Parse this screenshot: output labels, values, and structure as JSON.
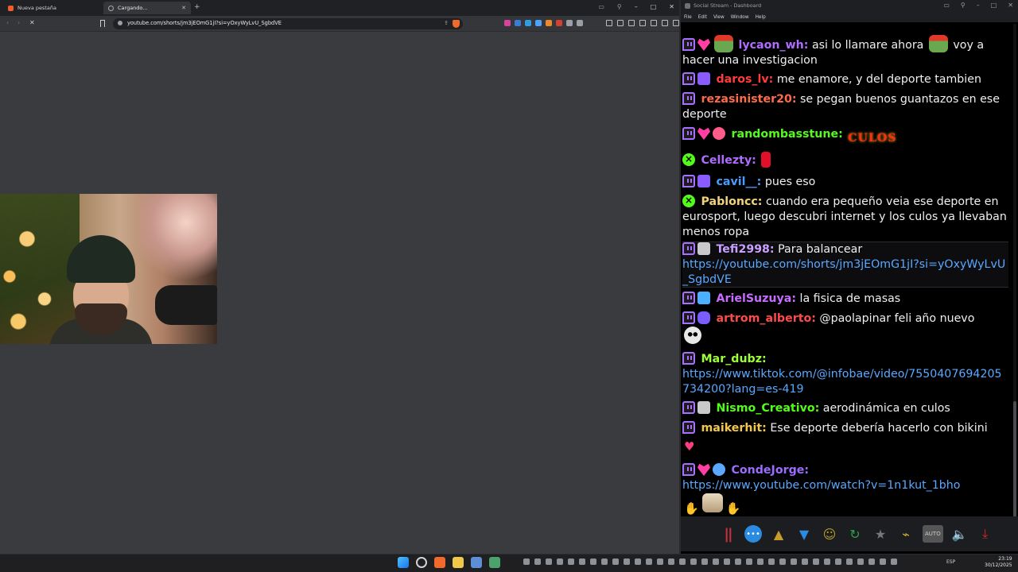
{
  "browser": {
    "tabs": [
      {
        "label": "Nueva pestaña"
      },
      {
        "label": "Cargando..."
      }
    ],
    "url": "youtube.com/shorts/jm3jEOmG1jI?si=yOxyWyLvU_SgbdVE"
  },
  "chat_app": {
    "title": "Social Stream - Dashboard",
    "menu": [
      "File",
      "Edit",
      "View",
      "Window",
      "Help"
    ],
    "messages": [
      {
        "user": "lycaon_wh:",
        "color": "#b06cff",
        "text": " asi lo llamare ahora ",
        "text2": " voy a hacer una investigacion"
      },
      {
        "user": "daros_lv:",
        "color": "#ff3b3b",
        "text": " me enamore, y del deporte tambien"
      },
      {
        "user": "rezasinister20:",
        "color": "#ff6a4a",
        "text": " se pegan buenos guantazos en ese deporte"
      },
      {
        "user": "randombasstune:",
        "color": "#53fc18",
        "emote_text": "CULOS"
      },
      {
        "user": "Cellezty:",
        "color": "#b06cff"
      },
      {
        "user": "cavil__:",
        "color": "#4a9bff",
        "text": " pues eso"
      },
      {
        "user": "Pabloncc:",
        "color": "#f3d37a",
        "text": " cuando era pequeño veia ese deporte en eurosport, luego descubri internet y los culos ya llevaban menos ropa"
      },
      {
        "user": "Tefi2998:",
        "color": "#c8a0ff",
        "text": " Para balancear",
        "link": "https://youtube.com/shorts/jm3jEOmG1jI?si=yOxyWyLvU_SgbdVE"
      },
      {
        "user": "ArielSuzuya:",
        "color": "#c86cff",
        "text": " la fisica de masas"
      },
      {
        "user": "artrom_alberto:",
        "color": "#ff4a4a",
        "text": " @paolapinar feli año nuevo"
      },
      {
        "user": "Mar_dubz:",
        "color": "#9cff3a",
        "link": "https://www.tiktok.com/@infobae/video/7550407694205734200?lang=es-419"
      },
      {
        "user": "Nismo_Creativo:",
        "color": "#53fc18",
        "text": " aerodinámica en culos"
      },
      {
        "user": "maikerhit:",
        "color": "#f3c84b",
        "text": " Ese deporte debería hacerlo con bikini"
      },
      {
        "user": "CondeJorge:",
        "color": "#9b6cff",
        "link": "https://www.youtube.com/watch?v=1n1kut_1bho"
      }
    ],
    "bottom": {
      "auto_label": "AUTO"
    }
  },
  "taskbar": {
    "lang": "ESP",
    "time": "23:19",
    "date": "30/12/2025"
  }
}
